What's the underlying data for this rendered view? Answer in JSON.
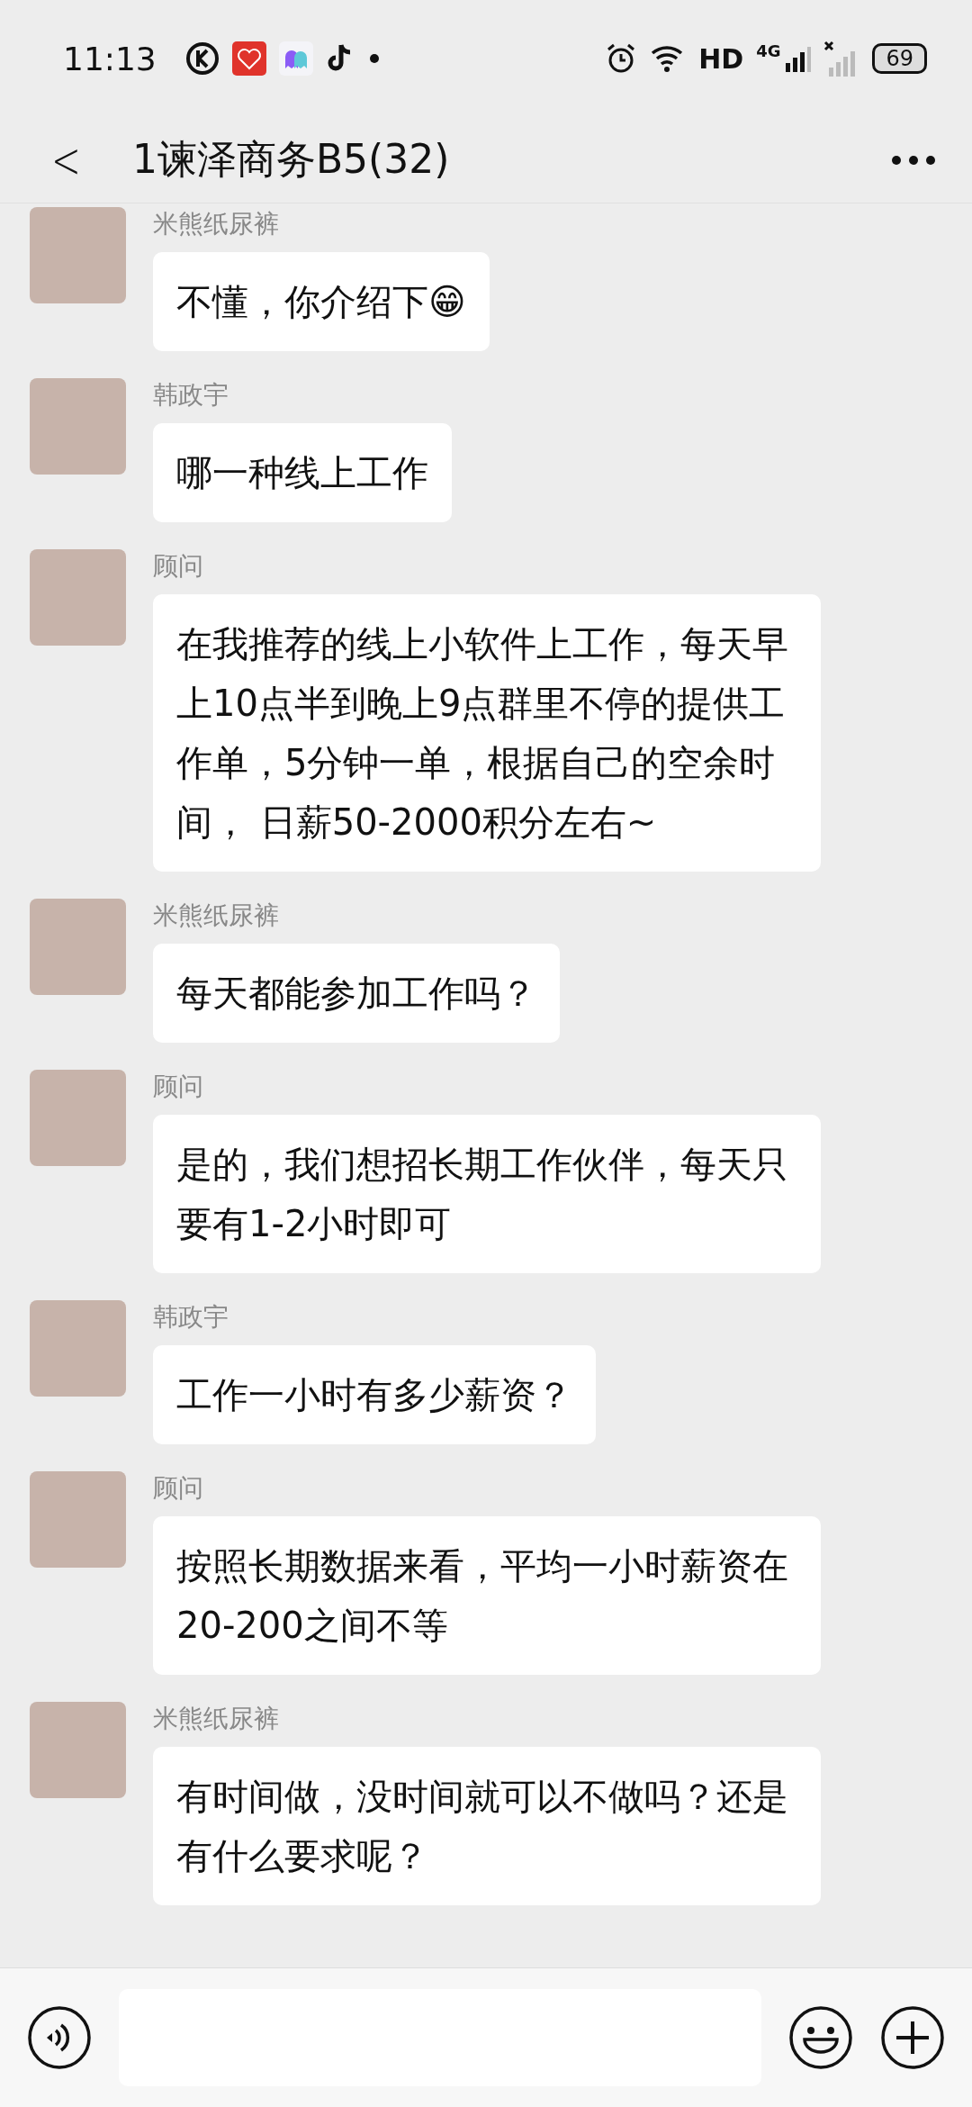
{
  "status_bar": {
    "time": "11:13",
    "battery": "69",
    "hd": "HD",
    "network": "4G"
  },
  "header": {
    "back": "<",
    "title": "1谏泽商务B5(32)"
  },
  "messages": [
    {
      "sender": "米熊纸尿裤",
      "text": "不懂，你介绍下😁"
    },
    {
      "sender": "韩政宇",
      "text": "哪一种线上工作"
    },
    {
      "sender": "顾问",
      "text": "在我推荐的线上小软件上工作，每天早上10点半到晚上9点群里不停的提供工作单，5分钟一单，根据自己的空余时间， 日薪50-2000积分左右~"
    },
    {
      "sender": "米熊纸尿裤",
      "text": "每天都能参加工作吗？"
    },
    {
      "sender": "顾问",
      "text": "是的，我们想招长期工作伙伴，每天只要有1-2小时即可"
    },
    {
      "sender": "韩政宇",
      "text": "工作一小时有多少薪资？"
    },
    {
      "sender": "顾问",
      "text": "按照长期数据来看，平均一小时薪资在20-200之间不等"
    },
    {
      "sender": "米熊纸尿裤",
      "text": "有时间做，没时间就可以不做吗？还是有什么要求呢？"
    }
  ]
}
